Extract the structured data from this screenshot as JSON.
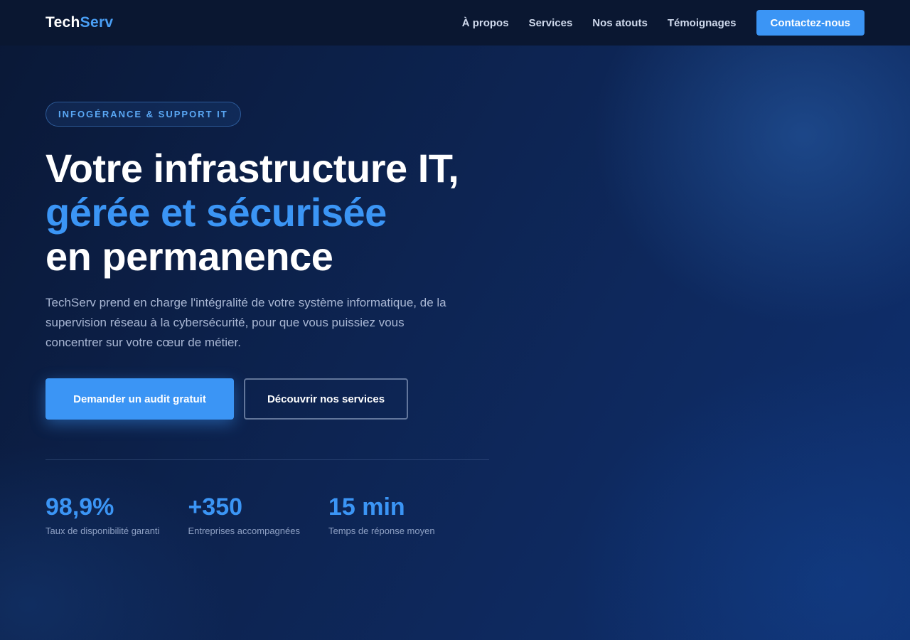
{
  "brand": {
    "part1": "Tech",
    "part2": "Serv"
  },
  "nav": {
    "links": [
      "À propos",
      "Services",
      "Nos atouts",
      "Témoignages"
    ],
    "cta": "Contactez-nous"
  },
  "hero": {
    "badge": "INFOGÉRANCE & SUPPORT IT",
    "title_line1": "Votre infrastructure IT,",
    "title_line2": "gérée et sécurisée",
    "title_line3": "en permanence",
    "description": "TechServ prend en charge l'intégralité de votre système informatique, de la supervision réseau à la cybersécurité, pour que vous puissiez vous concentrer sur votre cœur de métier.",
    "primary_button": "Demander un audit gratuit",
    "secondary_button": "Découvrir nos services"
  },
  "stats": [
    {
      "value": "98,9%",
      "label": "Taux de disponibilité garanti"
    },
    {
      "value": "+350",
      "label": "Entreprises accompagnées"
    },
    {
      "value": "15 min",
      "label": "Temps de réponse moyen"
    }
  ],
  "colors": {
    "accent": "#3b95f5",
    "background": "#0b1a3a",
    "navbar": "#0a1731"
  }
}
